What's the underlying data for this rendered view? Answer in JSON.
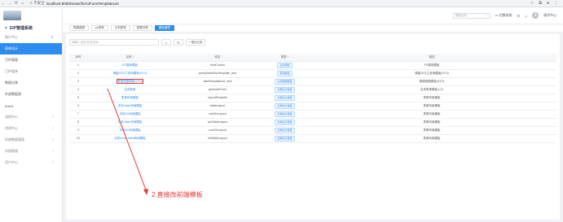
{
  "browser": {
    "back": "←",
    "forward": "→",
    "reload": "C",
    "home": "⌂",
    "insecure": "不安全",
    "url": "localhost:8080/views/form/FormTemplateList",
    "icons": [
      "star-icon",
      "extension-icon",
      "profile-icon",
      "menu-icon"
    ]
  },
  "app": {
    "brand": "EIP管理系统",
    "menu": [
      {
        "label": "图片中心",
        "chev": "∨",
        "state": "muted"
      },
      {
        "label": "表单设计",
        "chev": "",
        "state": "active"
      },
      {
        "label": "污件管理",
        "chev": "",
        "state": ""
      },
      {
        "label": "门户设计",
        "chev": "",
        "state": ""
      },
      {
        "label": "数据迁移",
        "chev": "",
        "state": ""
      },
      {
        "label": "外部数据源",
        "chev": "",
        "state": ""
      },
      {
        "label": "test01",
        "chev": "",
        "state": ""
      },
      {
        "label": "流程中心",
        "chev": "›",
        "state": "muted"
      },
      {
        "label": "消息中心",
        "chev": "›",
        "state": "muted"
      },
      {
        "label": "系统数据管理",
        "chev": "›",
        "state": "muted"
      },
      {
        "label": "系统管理",
        "chev": "›",
        "state": "muted"
      },
      {
        "label": "用户中心",
        "chev": "›",
        "state": "muted"
      }
    ]
  },
  "topbar": {
    "search_placeholder": "搜索应用",
    "links": [
      "切换系统",
      "消息",
      "通知",
      "清华中心"
    ],
    "avatar_letter": "清"
  },
  "tabs": [
    {
      "label": "数据建模",
      "active": false
    },
    {
      "label": "pc表单",
      "active": false
    },
    {
      "label": "手机表单",
      "active": false
    },
    {
      "label": "数据列表",
      "active": false
    },
    {
      "label": "模板管理",
      "active": true
    }
  ],
  "toolbar": {
    "search_placeholder": "请输入名称 别名查询",
    "search_icon": "search-icon",
    "refresh_icon": "refresh-icon",
    "add_label": "+ 增加记录"
  },
  "table": {
    "headers": [
      "序号",
      "名称 ↑",
      "别名",
      "类型 ↑",
      "描述"
    ],
    "rows": [
      {
        "no": "1",
        "name": "PC展现模板",
        "alias": "fieldControl",
        "type": "主表模板",
        "desc": "PC展现模板"
      },
      {
        "no": "2",
        "name": "弹窗JS与之查询模板(V3.0)",
        "alias": "queryDataViewTemplate_new",
        "type": "查询模板",
        "desc": "弹窗JS与之查询模板(V3.0)"
      },
      {
        "no": "3",
        "name": "数据视图模板(V3.0)",
        "alias": "dataTemplateList_new",
        "type": "业务数据模板",
        "desc": "数据视图模板(V3.0)"
      },
      {
        "no": "4",
        "name": "生成表单",
        "alias": "generateForm",
        "type": "表单设计模板",
        "desc": "生成表单模板入口"
      },
      {
        "no": "5",
        "name": "表单布局模板",
        "alias": "layoutTemplate",
        "type": "表单设计模板",
        "desc": "表单布局模板"
      },
      {
        "no": "6",
        "name": "手机 table布局模板",
        "alias": "tableLayout",
        "type": "表单设计模板",
        "desc": "表单布局模板"
      },
      {
        "no": "7",
        "name": "手机Div布局模板",
        "alias": "subDivLayout",
        "type": "表单设计模板",
        "desc": "表单布局模板"
      },
      {
        "no": "8",
        "name": "手机 table布局模板",
        "alias": "subTableLayout",
        "type": "表单设计模板",
        "desc": "表单布局模板"
      },
      {
        "no": "9",
        "name": "手机Div布局模板",
        "alias": "nonDivLayout",
        "type": "表单设计模板",
        "desc": "表单布局模板"
      },
      {
        "no": "10",
        "name": "手机noceLebbrt布局模板",
        "alias": "listTableLayout",
        "type": "表单设计模板",
        "desc": "表单布局模板"
      }
    ]
  },
  "annotation": {
    "text": "2.直接改前端模板",
    "color": "#e53935"
  },
  "colors": {
    "accent": "#2d8cf0",
    "annotation": "#e53935"
  }
}
